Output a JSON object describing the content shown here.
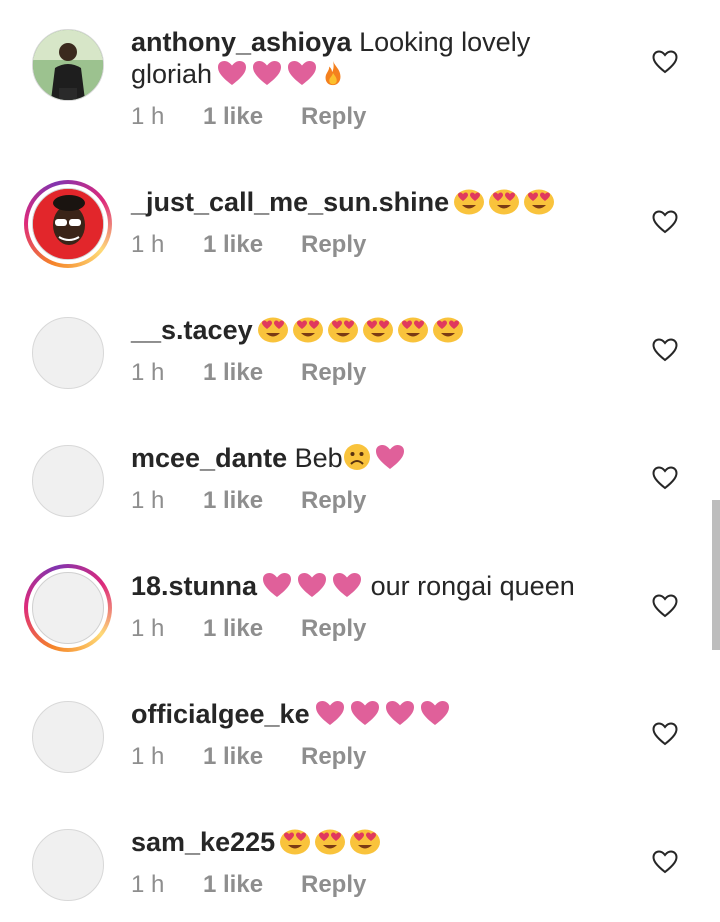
{
  "comments": [
    {
      "username": "anthony_ashioya",
      "text_line1": "Looking lovely",
      "text_line2": "gloriah",
      "emojis": [
        "heart",
        "heart",
        "heart",
        "fire"
      ],
      "time": "1 h",
      "likes": "1 like",
      "reply": "Reply",
      "avatar": "photo",
      "story_ring": false
    },
    {
      "username": "_just_call_me_sun.shine",
      "text": "",
      "emojis": [
        "heart-eyes",
        "heart-eyes",
        "heart-eyes"
      ],
      "time": "1 h",
      "likes": "1 like",
      "reply": "Reply",
      "avatar": "photo",
      "story_ring": true
    },
    {
      "username": "__s.tacey",
      "text": "",
      "emojis": [
        "heart-eyes",
        "heart-eyes",
        "heart-eyes",
        "heart-eyes",
        "heart-eyes",
        "heart-eyes"
      ],
      "time": "1 h",
      "likes": "1 like",
      "reply": "Reply",
      "avatar": "placeholder",
      "story_ring": false
    },
    {
      "username": "mcee_dante",
      "text": "Beb",
      "emojis": [
        "sad",
        "heart"
      ],
      "time": "1 h",
      "likes": "1 like",
      "reply": "Reply",
      "avatar": "placeholder",
      "story_ring": false
    },
    {
      "username": "18.stunna",
      "text": "our rongai queen",
      "emojis": [
        "heart",
        "heart",
        "heart"
      ],
      "time": "1 h",
      "likes": "1 like",
      "reply": "Reply",
      "avatar": "placeholder",
      "story_ring": true
    },
    {
      "username": "officialgee_ke",
      "text": "",
      "emojis": [
        "heart",
        "heart",
        "heart",
        "heart"
      ],
      "time": "1 h",
      "likes": "1 like",
      "reply": "Reply",
      "avatar": "placeholder",
      "story_ring": false
    },
    {
      "username": "sam_ke225",
      "text": "",
      "emojis": [
        "heart-eyes",
        "heart-eyes",
        "heart-eyes"
      ],
      "time": "1 h",
      "likes": "1 like",
      "reply": "Reply",
      "avatar": "placeholder",
      "story_ring": false
    }
  ],
  "colors": {
    "heart": "#e0609a",
    "emoji_yellow": "#f9c33c",
    "meta_gray": "#8e8e8e",
    "text": "#262626"
  }
}
